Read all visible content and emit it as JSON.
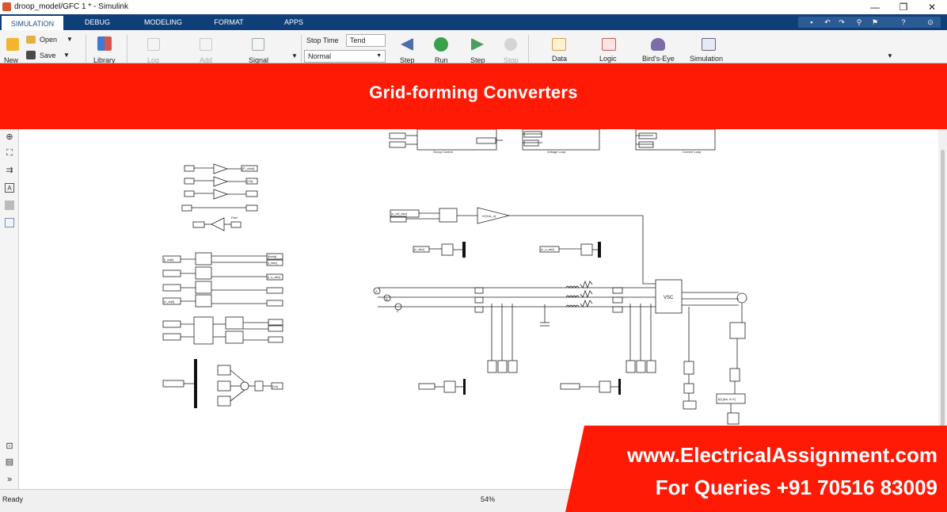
{
  "window": {
    "title": "droop_model/GFC 1 * - Simulink",
    "controls": [
      "—",
      "❐",
      "✕"
    ]
  },
  "ribbon_tabs": [
    "SIMULATION",
    "DEBUG",
    "MODELING",
    "FORMAT",
    "APPS"
  ],
  "ribbon": {
    "file": {
      "new": "New",
      "open": "Open",
      "save": "Save"
    },
    "library": "Library",
    "log": "Log",
    "add": "Add",
    "signal": "Signal",
    "stop_time_label": "Stop Time",
    "stop_time_value": "Tend",
    "sim_mode": "Normal",
    "step_back": "Step",
    "run": "Run",
    "step_fwd": "Step",
    "stop": "Stop",
    "data": "Data",
    "logic": "Logic",
    "birds_eye": "Bird's-Eye",
    "simulation": "Simulation"
  },
  "banner": {
    "title": "Grid-forming Converters"
  },
  "diagram": {
    "droop_control": "Droop Control",
    "voltage_loop": "Voltage Loop",
    "current_loop": "Current Loop",
    "vsc": "VSC",
    "gain_label": "2/(Vdc_n)",
    "integrator_label": "Pacl",
    "param_block": "f(t) [kw, d=1]",
    "source_labels": [
      "A",
      "B",
      "C"
    ],
    "tags": {
      "p_wind": "[P_wind]",
      "theta": "[theta]",
      "i_abc": "[i_abc]",
      "i_s_abc": "[i_s_abc]",
      "v_abc": "[v_abc]",
      "v_s_abc": "[v_s_abc]",
      "v_dq0": "[v_dq0]",
      "i_dq0": "[i_dq0]",
      "vd": "[Vd]",
      "vs": "[Vs]",
      "u_ref_abc": "[u_ref_abc]"
    }
  },
  "status": {
    "ready": "Ready",
    "zoom": "54%"
  },
  "watermark": {
    "site": "www.ElectricalAssignment.com",
    "phone": "For Queries +91 70516 83009"
  },
  "colors": {
    "banner": "#ff1a05",
    "tabbar": "#0f3f78",
    "watermark": "#ff1a05"
  }
}
